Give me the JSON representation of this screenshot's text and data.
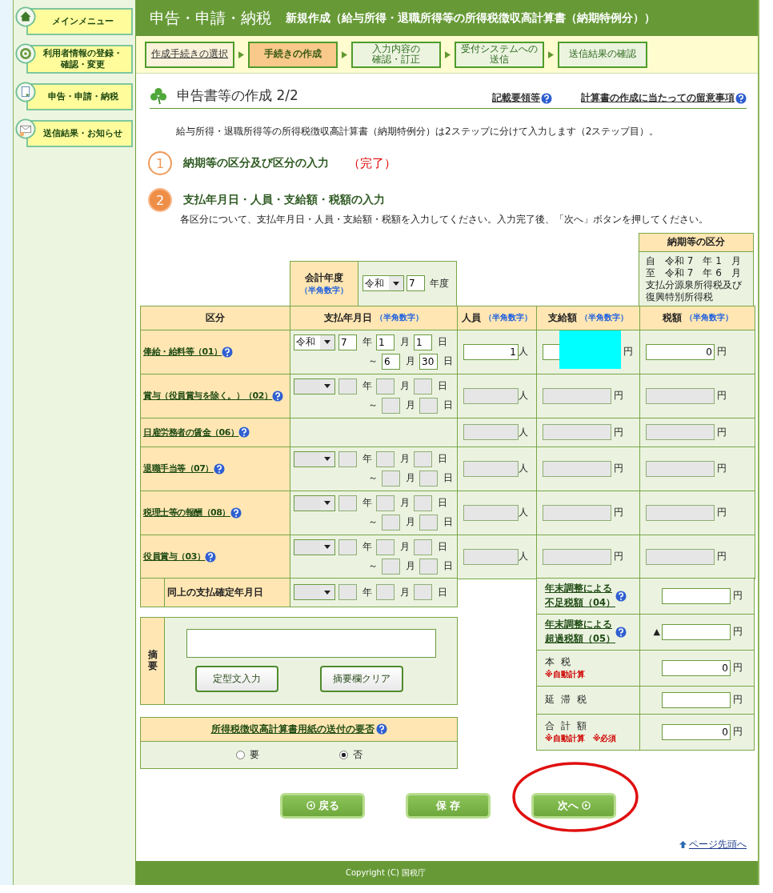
{
  "sidebar": {
    "items": [
      {
        "lines": [
          "メインメニュー"
        ]
      },
      {
        "lines": [
          "利用者情報の登録・",
          "確認・変更"
        ]
      },
      {
        "lines": [
          "申告・申請・納税"
        ]
      },
      {
        "lines": [
          "送信結果・お知らせ"
        ]
      }
    ]
  },
  "header": {
    "title": "申告・申請・納税",
    "subtitle": "新規作成（給与所得・退職所得等の所得税徴収高計算書（納期特例分））"
  },
  "steps": [
    {
      "lines": [
        "作成手続きの選択"
      ],
      "done": true,
      "selected": false
    },
    {
      "lines": [
        "手続きの作成"
      ],
      "done": false,
      "selected": true
    },
    {
      "lines": [
        "入力内容の",
        "確認・訂正"
      ],
      "done": false,
      "selected": false
    },
    {
      "lines": [
        "受付システムへの",
        "送信"
      ],
      "done": false,
      "selected": false
    },
    {
      "lines": [
        "送信結果の確認"
      ],
      "done": false,
      "selected": false
    }
  ],
  "section": {
    "title": "申告書等の作成 2/2",
    "links": [
      {
        "label": "記載要領等",
        "help": true
      },
      {
        "label": "計算書の作成に当たっての留意事項",
        "help": true
      }
    ]
  },
  "intro": "給与所得・退職所得等の所得税徴収高計算書（納期特例分）は2ステップに分けて入力します（2ステップ目）。",
  "progress": [
    {
      "number": "1",
      "title": "納期等の区分及び区分の入力",
      "status_text": "（完了）",
      "active": false
    },
    {
      "number": "2",
      "title": "支払年月日・人員・支給額・税額の入力",
      "description": "各区分について、支払年月日・人員・支給額・税額を入力してください。入力完了後、「次へ」ボタンを押してください。",
      "active": true
    }
  ],
  "fiscal_year": {
    "label": "会計年度",
    "hint": "（半角数字）",
    "era": "令和",
    "year": "7",
    "unit": "年度"
  },
  "period": {
    "title": "納期等の区分",
    "lines": [
      "自　令和 7　年 1　月",
      "至　令和 7　年 6　月",
      "支払分源泉所得税及び復興特別所得税"
    ]
  },
  "table": {
    "columns": [
      {
        "label": "区分"
      },
      {
        "label": "支払年月日",
        "hint": "（半角数字）"
      },
      {
        "label": "人員",
        "hint": "（半角数字）"
      },
      {
        "label": "支給額",
        "hint": "（半角数字）"
      },
      {
        "label": "税額",
        "hint": "（半角数字）"
      }
    ],
    "rows": [
      {
        "label": "俸給・給料等（01）",
        "help": true,
        "kind": "date-range",
        "disabled": false,
        "era": "令和",
        "from": [
          {
            "value": "7",
            "unit": "年"
          },
          {
            "value": "1",
            "unit": "月"
          },
          {
            "value": "1",
            "unit": "日"
          }
        ],
        "to_mark": "～",
        "to": [
          {
            "value": "6",
            "unit": "月"
          },
          {
            "value": "30",
            "unit": "日"
          }
        ],
        "persons": {
          "value": "1",
          "unit": "人"
        },
        "amount": {
          "unit": "円",
          "redacted": true
        },
        "tax": {
          "value": "0",
          "unit": "円"
        }
      },
      {
        "label": "賞与（役員賞与を除く。）（02）",
        "help": true,
        "kind": "date-range",
        "disabled": true,
        "from": [
          {
            "unit": "年"
          },
          {
            "unit": "月"
          },
          {
            "unit": "日"
          }
        ],
        "to_mark": "～",
        "to": [
          {
            "unit": "月"
          },
          {
            "unit": "日"
          }
        ],
        "persons": {
          "unit": "人"
        },
        "amount": {
          "unit": "円",
          "redacted": false
        },
        "tax": {
          "unit": "円"
        }
      },
      {
        "label": "日雇労務者の賃金（06）",
        "help": true,
        "kind": "no-date",
        "disabled": true,
        "persons": {
          "unit": "人"
        },
        "amount": {
          "unit": "円",
          "redacted": false
        },
        "tax": {
          "unit": "円"
        }
      },
      {
        "label": "退職手当等（07）",
        "help": true,
        "kind": "date-range",
        "disabled": true,
        "from": [
          {
            "unit": "年"
          },
          {
            "unit": "月"
          },
          {
            "unit": "日"
          }
        ],
        "to_mark": "～",
        "to": [
          {
            "unit": "月"
          },
          {
            "unit": "日"
          }
        ],
        "persons": {
          "unit": "人"
        },
        "amount": {
          "unit": "円",
          "redacted": false
        },
        "tax": {
          "unit": "円"
        }
      },
      {
        "label": "税理士等の報酬（08）",
        "help": true,
        "kind": "date-range",
        "disabled": true,
        "from": [
          {
            "unit": "年"
          },
          {
            "unit": "月"
          },
          {
            "unit": "日"
          }
        ],
        "to_mark": "～",
        "to": [
          {
            "unit": "月"
          },
          {
            "unit": "日"
          }
        ],
        "persons": {
          "unit": "人"
        },
        "amount": {
          "unit": "円",
          "redacted": false
        },
        "tax": {
          "unit": "円"
        }
      },
      {
        "label": "役員賞与（03）",
        "help": true,
        "kind": "date-range",
        "disabled": true,
        "from": [
          {
            "unit": "年"
          },
          {
            "unit": "月"
          },
          {
            "unit": "日"
          }
        ],
        "to_mark": "～",
        "to": [
          {
            "unit": "月"
          },
          {
            "unit": "日"
          }
        ],
        "persons": {
          "unit": "人"
        },
        "amount": {
          "unit": "円",
          "redacted": false
        },
        "tax": {
          "unit": "円"
        }
      }
    ]
  },
  "confirm_row": {
    "label": "同上の支払確定年月日",
    "disabled": true,
    "parts": [
      {
        "unit": "年"
      },
      {
        "unit": "月"
      },
      {
        "unit": "日"
      }
    ]
  },
  "adjustments": [
    {
      "lines": [
        "年末調整による",
        "不足税額（04）"
      ],
      "kind": "link",
      "help": true,
      "unit": "円"
    },
    {
      "lines": [
        "年末調整による",
        "超過税額（05）"
      ],
      "kind": "link",
      "help": true,
      "prefix": "▲",
      "unit": "円"
    },
    {
      "lines": [
        "本 税"
      ],
      "kind": "plain",
      "note": "※自動計算",
      "value": "0",
      "unit": "円"
    },
    {
      "lines": [
        "延 滞 税"
      ],
      "kind": "plain",
      "unit": "円"
    },
    {
      "lines": [
        "合 計 額"
      ],
      "kind": "plain",
      "note": "※自動計算　※必須",
      "value": "0",
      "unit": "円"
    }
  ],
  "remarks": {
    "label": "摘要",
    "buttons": [
      "定型文入力",
      "摘要欄クリア"
    ]
  },
  "send_form": {
    "title": "所得税徴収高計算書用紙の送付の要否",
    "help": true,
    "options": [
      {
        "label": "要",
        "selected": false
      },
      {
        "label": "否",
        "selected": true
      }
    ]
  },
  "actions": [
    {
      "label": "戻る",
      "kind": "back"
    },
    {
      "label": "保 存",
      "kind": "save"
    },
    {
      "label": "次へ",
      "kind": "next"
    }
  ],
  "annotations": [
    {
      "kind": "ellipse"
    }
  ],
  "page_top_link": "ページ先頭へ",
  "footer": "Copyright (C) 国税庁"
}
